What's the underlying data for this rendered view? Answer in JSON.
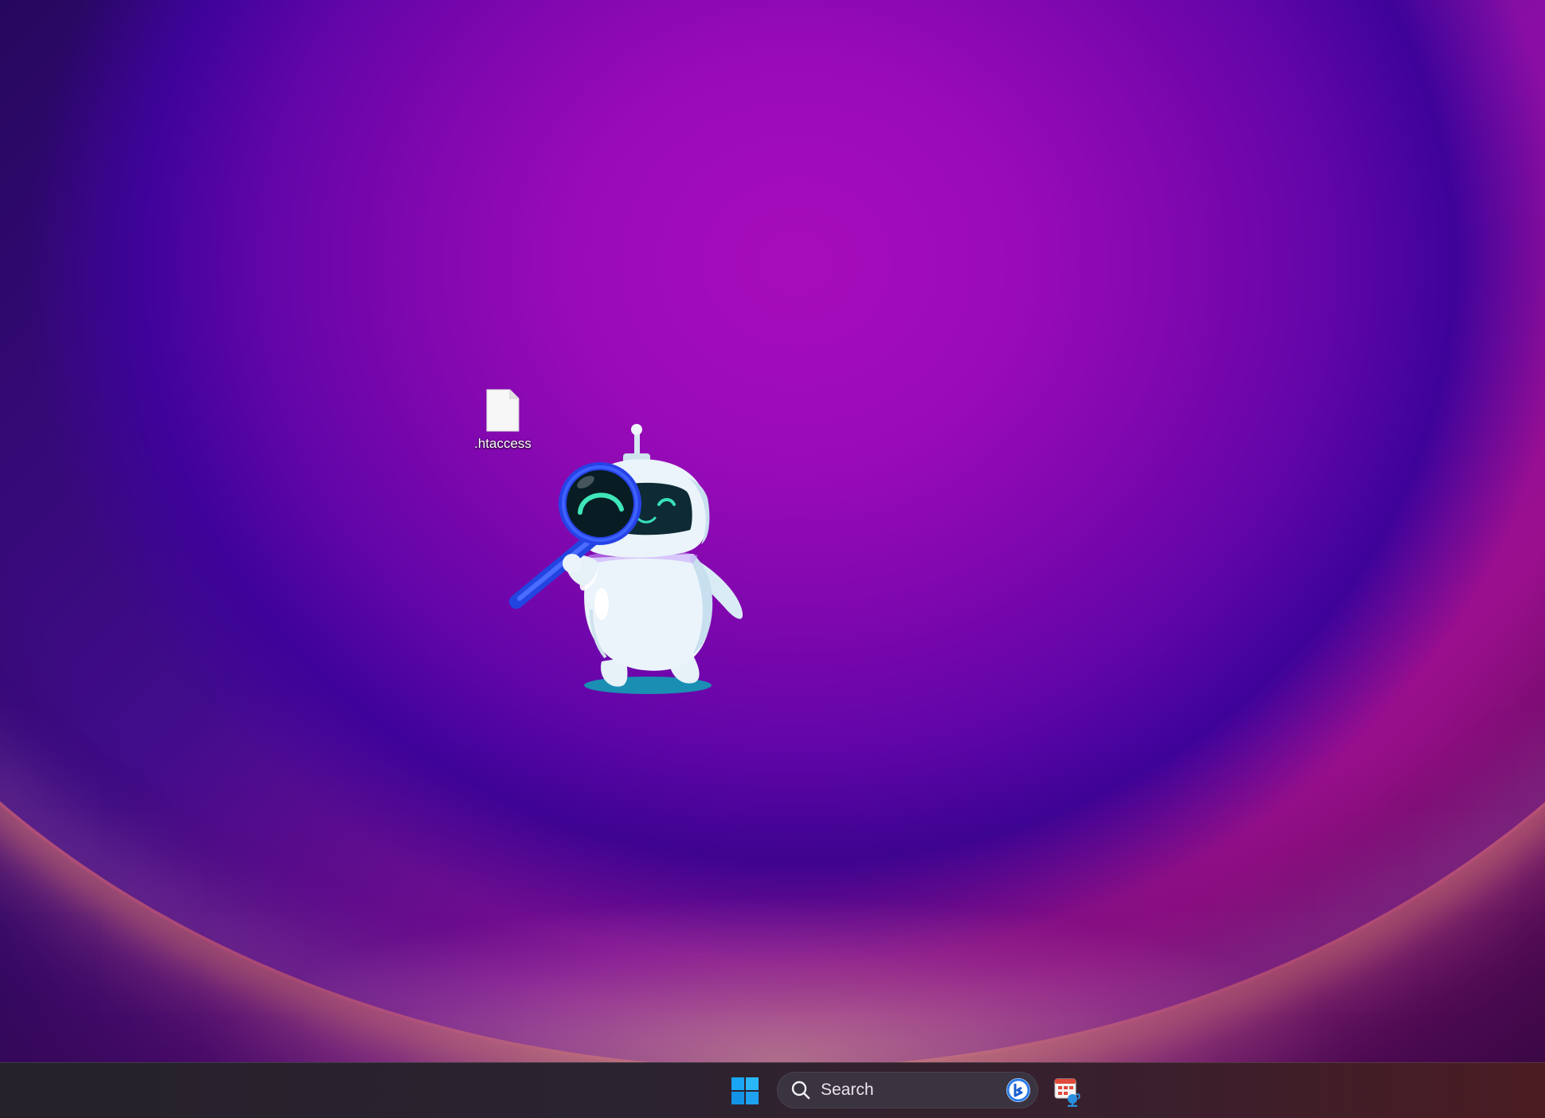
{
  "desktop": {
    "icons": [
      {
        "label": ".htaccess",
        "icon": "file-icon"
      }
    ],
    "wallpaper": {
      "primary_color": "#9a0bb8",
      "secondary_color": "#3e039a",
      "glow_color": "#ff7aa0"
    },
    "mascot": "robot-magnifier-illustration"
  },
  "taskbar": {
    "start_icon": "windows-logo-icon",
    "start_color": "#1aa0f0",
    "search": {
      "placeholder": "Search",
      "icon": "search-icon",
      "badge_icon": "bing-icon"
    },
    "pinned_apps": [
      {
        "icon": "app-icon"
      }
    ]
  }
}
